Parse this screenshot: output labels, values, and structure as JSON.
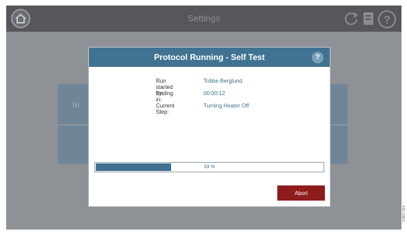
{
  "topbar": {
    "title": "Settings",
    "icons": [
      "home-icon",
      "refresh-icon",
      "document-icon",
      "help-icon"
    ]
  },
  "background": {
    "panel_label": "In"
  },
  "dialog": {
    "title": "Protocol Running - Self Test",
    "help_icon": "?",
    "fields": [
      {
        "label": "Run started by:",
        "value": "Tobbe Berglund"
      },
      {
        "label": "Ending in:",
        "value": "00:00:12"
      },
      {
        "label": "Current Step:",
        "value": "Turning Heater Off"
      }
    ],
    "progress": {
      "percent": 33,
      "text": "33 %"
    },
    "abort_label": "Abort"
  },
  "figure_note": "17807-014",
  "colors": {
    "accent": "#3f7391",
    "abort": "#8e1c1c",
    "topbar": "#55575b",
    "overlay": "#8e9296"
  }
}
